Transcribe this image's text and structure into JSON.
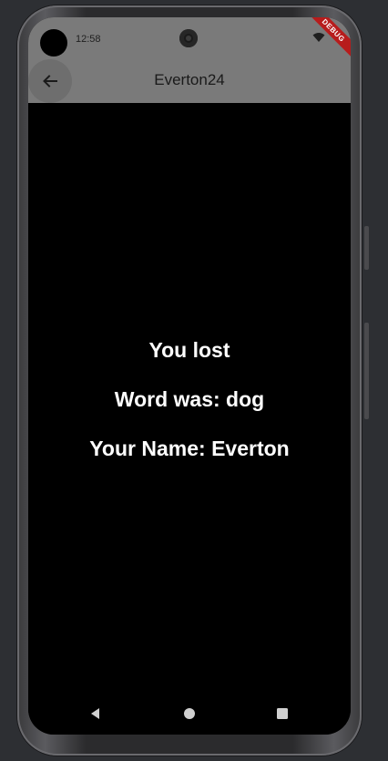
{
  "status_bar": {
    "time": "12:58",
    "debug_label": "DEBUG"
  },
  "app_bar": {
    "title": "Everton24",
    "back_icon": "arrow-left-icon"
  },
  "result": {
    "line1": "You lost",
    "line2": "Word was: dog",
    "line3": "Your Name: Everton"
  },
  "nav": {
    "back_icon": "triangle-back-icon",
    "home_icon": "circle-home-icon",
    "recents_icon": "square-recents-icon"
  },
  "colors": {
    "app_bar": "#7a7a7a",
    "background": "#000000",
    "text": "#ffffff",
    "debug_ribbon": "#b71c1c"
  }
}
